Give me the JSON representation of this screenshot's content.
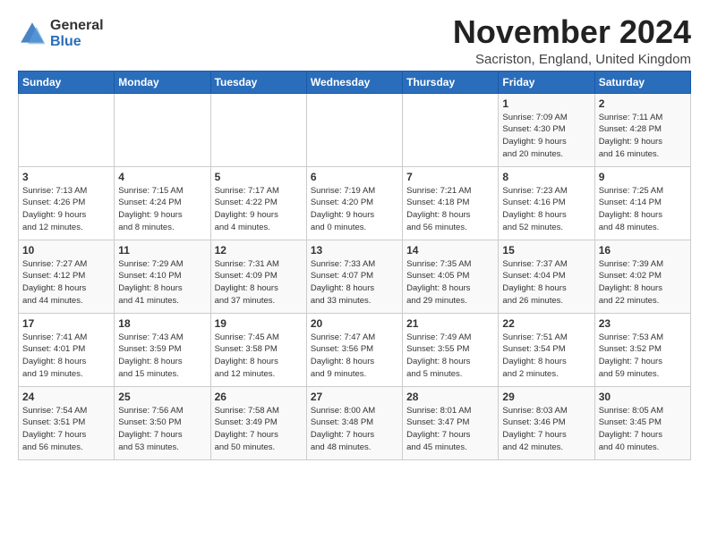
{
  "logo": {
    "general": "General",
    "blue": "Blue"
  },
  "title": "November 2024",
  "subtitle": "Sacriston, England, United Kingdom",
  "days_header": [
    "Sunday",
    "Monday",
    "Tuesday",
    "Wednesday",
    "Thursday",
    "Friday",
    "Saturday"
  ],
  "weeks": [
    [
      {
        "day": "",
        "detail": ""
      },
      {
        "day": "",
        "detail": ""
      },
      {
        "day": "",
        "detail": ""
      },
      {
        "day": "",
        "detail": ""
      },
      {
        "day": "",
        "detail": ""
      },
      {
        "day": "1",
        "detail": "Sunrise: 7:09 AM\nSunset: 4:30 PM\nDaylight: 9 hours\nand 20 minutes."
      },
      {
        "day": "2",
        "detail": "Sunrise: 7:11 AM\nSunset: 4:28 PM\nDaylight: 9 hours\nand 16 minutes."
      }
    ],
    [
      {
        "day": "3",
        "detail": "Sunrise: 7:13 AM\nSunset: 4:26 PM\nDaylight: 9 hours\nand 12 minutes."
      },
      {
        "day": "4",
        "detail": "Sunrise: 7:15 AM\nSunset: 4:24 PM\nDaylight: 9 hours\nand 8 minutes."
      },
      {
        "day": "5",
        "detail": "Sunrise: 7:17 AM\nSunset: 4:22 PM\nDaylight: 9 hours\nand 4 minutes."
      },
      {
        "day": "6",
        "detail": "Sunrise: 7:19 AM\nSunset: 4:20 PM\nDaylight: 9 hours\nand 0 minutes."
      },
      {
        "day": "7",
        "detail": "Sunrise: 7:21 AM\nSunset: 4:18 PM\nDaylight: 8 hours\nand 56 minutes."
      },
      {
        "day": "8",
        "detail": "Sunrise: 7:23 AM\nSunset: 4:16 PM\nDaylight: 8 hours\nand 52 minutes."
      },
      {
        "day": "9",
        "detail": "Sunrise: 7:25 AM\nSunset: 4:14 PM\nDaylight: 8 hours\nand 48 minutes."
      }
    ],
    [
      {
        "day": "10",
        "detail": "Sunrise: 7:27 AM\nSunset: 4:12 PM\nDaylight: 8 hours\nand 44 minutes."
      },
      {
        "day": "11",
        "detail": "Sunrise: 7:29 AM\nSunset: 4:10 PM\nDaylight: 8 hours\nand 41 minutes."
      },
      {
        "day": "12",
        "detail": "Sunrise: 7:31 AM\nSunset: 4:09 PM\nDaylight: 8 hours\nand 37 minutes."
      },
      {
        "day": "13",
        "detail": "Sunrise: 7:33 AM\nSunset: 4:07 PM\nDaylight: 8 hours\nand 33 minutes."
      },
      {
        "day": "14",
        "detail": "Sunrise: 7:35 AM\nSunset: 4:05 PM\nDaylight: 8 hours\nand 29 minutes."
      },
      {
        "day": "15",
        "detail": "Sunrise: 7:37 AM\nSunset: 4:04 PM\nDaylight: 8 hours\nand 26 minutes."
      },
      {
        "day": "16",
        "detail": "Sunrise: 7:39 AM\nSunset: 4:02 PM\nDaylight: 8 hours\nand 22 minutes."
      }
    ],
    [
      {
        "day": "17",
        "detail": "Sunrise: 7:41 AM\nSunset: 4:01 PM\nDaylight: 8 hours\nand 19 minutes."
      },
      {
        "day": "18",
        "detail": "Sunrise: 7:43 AM\nSunset: 3:59 PM\nDaylight: 8 hours\nand 15 minutes."
      },
      {
        "day": "19",
        "detail": "Sunrise: 7:45 AM\nSunset: 3:58 PM\nDaylight: 8 hours\nand 12 minutes."
      },
      {
        "day": "20",
        "detail": "Sunrise: 7:47 AM\nSunset: 3:56 PM\nDaylight: 8 hours\nand 9 minutes."
      },
      {
        "day": "21",
        "detail": "Sunrise: 7:49 AM\nSunset: 3:55 PM\nDaylight: 8 hours\nand 5 minutes."
      },
      {
        "day": "22",
        "detail": "Sunrise: 7:51 AM\nSunset: 3:54 PM\nDaylight: 8 hours\nand 2 minutes."
      },
      {
        "day": "23",
        "detail": "Sunrise: 7:53 AM\nSunset: 3:52 PM\nDaylight: 7 hours\nand 59 minutes."
      }
    ],
    [
      {
        "day": "24",
        "detail": "Sunrise: 7:54 AM\nSunset: 3:51 PM\nDaylight: 7 hours\nand 56 minutes."
      },
      {
        "day": "25",
        "detail": "Sunrise: 7:56 AM\nSunset: 3:50 PM\nDaylight: 7 hours\nand 53 minutes."
      },
      {
        "day": "26",
        "detail": "Sunrise: 7:58 AM\nSunset: 3:49 PM\nDaylight: 7 hours\nand 50 minutes."
      },
      {
        "day": "27",
        "detail": "Sunrise: 8:00 AM\nSunset: 3:48 PM\nDaylight: 7 hours\nand 48 minutes."
      },
      {
        "day": "28",
        "detail": "Sunrise: 8:01 AM\nSunset: 3:47 PM\nDaylight: 7 hours\nand 45 minutes."
      },
      {
        "day": "29",
        "detail": "Sunrise: 8:03 AM\nSunset: 3:46 PM\nDaylight: 7 hours\nand 42 minutes."
      },
      {
        "day": "30",
        "detail": "Sunrise: 8:05 AM\nSunset: 3:45 PM\nDaylight: 7 hours\nand 40 minutes."
      }
    ]
  ]
}
